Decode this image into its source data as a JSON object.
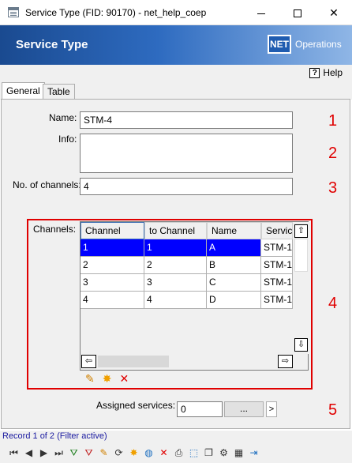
{
  "window": {
    "title": "Service Type (FID: 90170) - net_help_coep"
  },
  "banner": {
    "title": "Service Type",
    "logo_text": "NET",
    "product": "Operations"
  },
  "help": {
    "label": "Help",
    "icon": "?"
  },
  "tabs": [
    {
      "label": "General"
    },
    {
      "label": "Table"
    }
  ],
  "form": {
    "name_label": "Name:",
    "name_value": "STM-4",
    "info_label": "Info:",
    "info_value": "",
    "channels_count_label": "No. of channels:",
    "channels_count_value": "4",
    "channels_label": "Channels:",
    "assigned_label": "Assigned services:",
    "assigned_value": "0",
    "dots_label": "...",
    "go_label": ">"
  },
  "annotations": [
    "1",
    "2",
    "3",
    "4",
    "5"
  ],
  "grid": {
    "columns": [
      "Channel",
      "to Channel",
      "Name",
      "Servic"
    ],
    "rows": [
      [
        "1",
        "1",
        "A",
        "STM-1"
      ],
      [
        "2",
        "2",
        "B",
        "STM-1"
      ],
      [
        "3",
        "3",
        "C",
        "STM-1"
      ],
      [
        "4",
        "4",
        "D",
        "STM-1"
      ]
    ],
    "selected_row": 1
  },
  "status": {
    "text": "Record 1 of 2 (Filter active)"
  },
  "colors": {
    "accent": "#1a4a90",
    "highlight": "#e00000",
    "selection": "#0000ff"
  }
}
